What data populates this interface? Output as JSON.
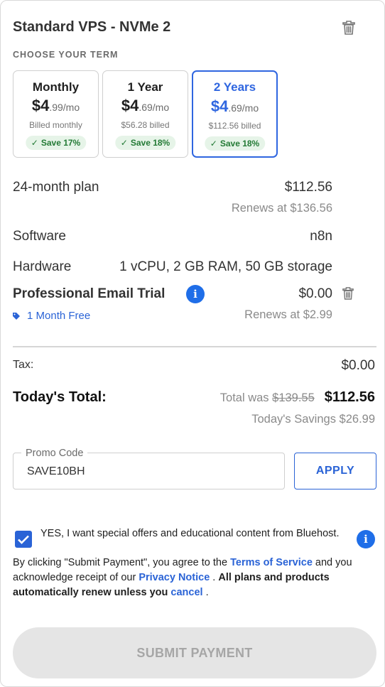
{
  "header": {
    "title": "Standard VPS - NVMe 2"
  },
  "term": {
    "label": "CHOOSE YOUR TERM",
    "options": [
      {
        "name": "Monthly",
        "dollar": "$4",
        "cents": ".99/mo",
        "billed": "Billed monthly",
        "save": "Save 17%",
        "selected": false
      },
      {
        "name": "1 Year",
        "dollar": "$4",
        "cents": ".69/mo",
        "billed": "$56.28 billed",
        "save": "Save 18%",
        "selected": false
      },
      {
        "name": "2 Years",
        "dollar": "$4",
        "cents": ".69/mo",
        "billed": "$112.56 billed",
        "save": "Save 18%",
        "selected": true
      }
    ]
  },
  "summary": {
    "plan_label": "24-month plan",
    "plan_price": "$112.56",
    "plan_renews": "Renews at $136.56",
    "software_label": "Software",
    "software_value": "n8n",
    "hardware_label": "Hardware",
    "hardware_value": "1 vCPU, 2 GB RAM, 50 GB storage",
    "email_label": "Professional Email Trial",
    "email_price": "$0.00",
    "email_tag": "1 Month Free",
    "email_renews": "Renews at $2.99"
  },
  "totals": {
    "tax_label": "Tax:",
    "tax_value": "$0.00",
    "total_label": "Today's Total:",
    "total_was_prefix": "Total was ",
    "total_was_value": "$139.55",
    "total_value": "$112.56",
    "savings": "Today's Savings $26.99"
  },
  "promo": {
    "label": "Promo Code",
    "value": "SAVE10BH",
    "apply_label": "APPLY"
  },
  "consent": {
    "offer_text": "YES, I want special offers and educational content from Bluehost.",
    "checked": true,
    "legal_prefix": "By clicking \"Submit Payment\", you agree to the ",
    "terms_link": "Terms of Service",
    "legal_mid": " and you acknowledge receipt of our ",
    "privacy_link": "Privacy Notice",
    "legal_sep": " .  ",
    "auto_renew": "All plans and products automatically renew unless you ",
    "cancel_link": "cancel",
    "legal_end": " ."
  },
  "submit": {
    "label": "SUBMIT PAYMENT"
  },
  "icons": {
    "trash": "trash-icon",
    "info": "info-icon",
    "tag": "tag-icon",
    "check": "check-icon"
  },
  "colors": {
    "accent": "#2a63d6",
    "selected_border": "#2f66e0",
    "save_bg": "#e6f4e8",
    "save_text": "#237a35",
    "info_blue": "#1f6ee8",
    "disabled_bg": "#e5e5e5"
  }
}
